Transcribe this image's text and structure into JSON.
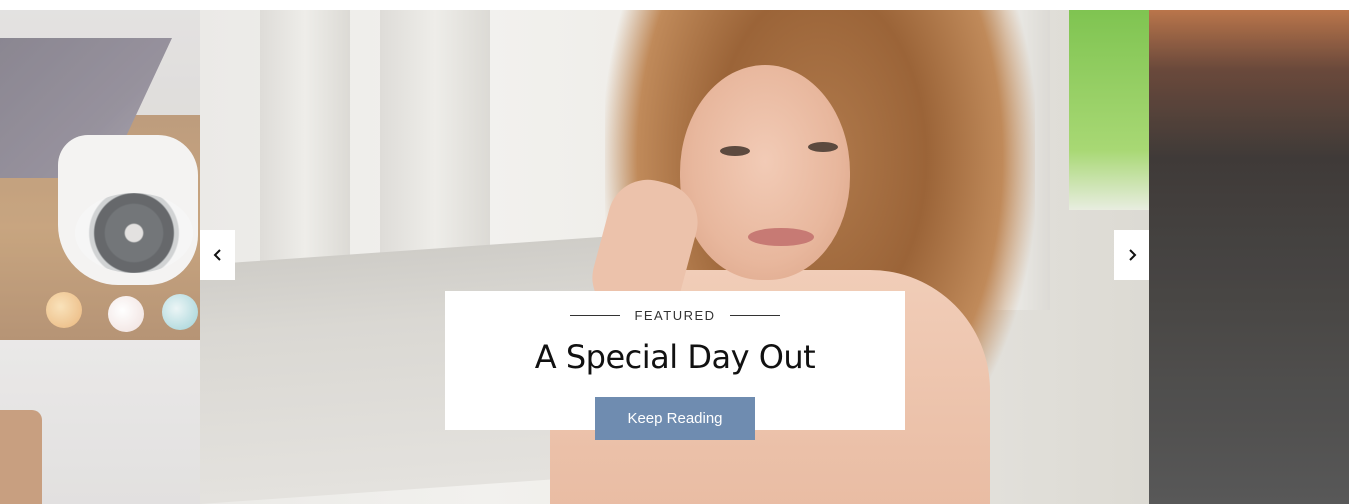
{
  "slider": {
    "prev_icon": "chevron-left-icon",
    "next_icon": "chevron-right-icon",
    "caption": {
      "kicker": "FEATURED",
      "title": "A Special Day Out",
      "button_label": "Keep Reading"
    }
  },
  "colors": {
    "button_bg": "#6f8cb0",
    "caption_bg": "#ffffff",
    "text": "#111111"
  }
}
